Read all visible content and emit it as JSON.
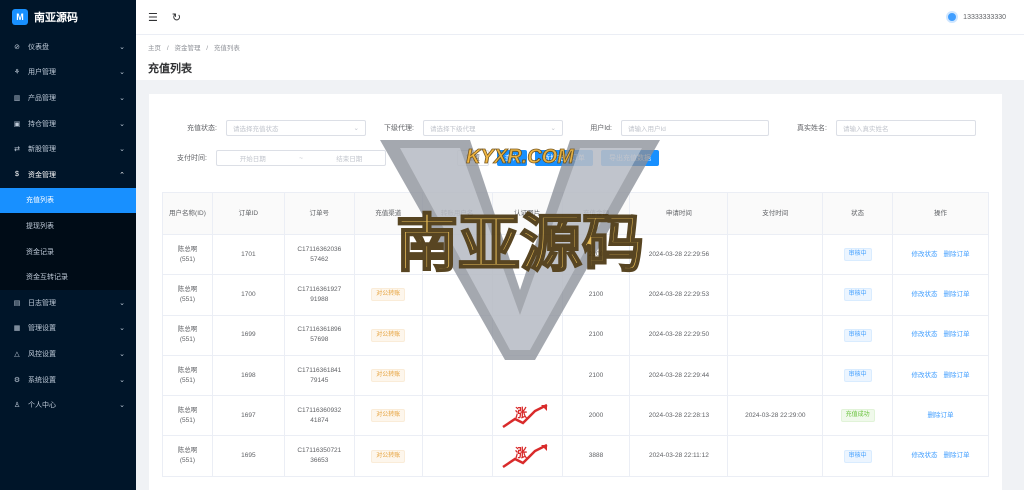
{
  "app": {
    "logo_text": "南亚源码",
    "logo_glyph": "M"
  },
  "sidebar": {
    "items": [
      {
        "label": "仪表盘",
        "icon": "dashboard-icon",
        "glyph": "⊘"
      },
      {
        "label": "用户管理",
        "icon": "users-icon",
        "glyph": "⚘"
      },
      {
        "label": "产品管理",
        "icon": "chart-icon",
        "glyph": "▥"
      },
      {
        "label": "持仓管理",
        "icon": "portfolio-icon",
        "glyph": "▣"
      },
      {
        "label": "新股管理",
        "icon": "ipo-icon",
        "glyph": "⇄"
      },
      {
        "label": "资金管理",
        "icon": "money-icon",
        "glyph": "$"
      }
    ],
    "sub_items": [
      "充值列表",
      "提现列表",
      "资金记录",
      "资金互转记录"
    ],
    "items2": [
      {
        "label": "日志管理",
        "icon": "log-icon",
        "glyph": "▤"
      },
      {
        "label": "管理设置",
        "icon": "settings-grid-icon",
        "glyph": "▦"
      },
      {
        "label": "风控设置",
        "icon": "warning-icon",
        "glyph": "△"
      },
      {
        "label": "系统设置",
        "icon": "gear-icon",
        "glyph": "⚙"
      },
      {
        "label": "个人中心",
        "icon": "person-icon",
        "glyph": "♙"
      }
    ]
  },
  "topbar": {
    "menu_glyph": "☰",
    "refresh_glyph": "↻",
    "username": "13333333330"
  },
  "breadcrumb": [
    "主页",
    "/",
    "资金管理",
    "/",
    "充值列表"
  ],
  "page_title": "充值列表",
  "filters": {
    "status_label": "充值状态:",
    "status_placeholder": "请选择充值状态",
    "agent_label": "下级代理:",
    "agent_placeholder": "请选择下级代理",
    "userid_label": "用户Id:",
    "userid_placeholder": "请输入用户Id",
    "realname_label": "真实姓名:",
    "realname_placeholder": "请输入真实姓名",
    "paytime_label": "支付时间:",
    "start_placeholder": "开始日期",
    "range_sep": "~",
    "end_placeholder": "结束日期",
    "search_btn": "查询",
    "reset_btn": "重置",
    "add_btn": "新增充值订单",
    "export_btn": "导出充值数据"
  },
  "table": {
    "headers": [
      "用户名称(ID)",
      "订单ID",
      "订单号",
      "充值渠道",
      "转账用户名",
      "认证图片",
      "充值金额",
      "申请时间",
      "支付时间",
      "状态",
      "操作"
    ],
    "rows": [
      {
        "user": "陈总啊",
        "uid": "(551)",
        "id": "1701",
        "order1": "C17116362036",
        "order2": "57462",
        "channel": "",
        "img": "",
        "amount": "2100",
        "apply": "2024-03-28 22:29:56",
        "paid": "",
        "status": "审核中",
        "status_color": "blue",
        "ops": [
          "修改状态",
          "删除订单"
        ]
      },
      {
        "user": "陈总啊",
        "uid": "(551)",
        "id": "1700",
        "order1": "C17116361927",
        "order2": "91988",
        "channel": "对公转账",
        "img": "",
        "amount": "2100",
        "apply": "2024-03-28 22:29:53",
        "paid": "",
        "status": "审核中",
        "status_color": "blue",
        "ops": [
          "修改状态",
          "删除订单"
        ]
      },
      {
        "user": "陈总啊",
        "uid": "(551)",
        "id": "1699",
        "order1": "C17116361896",
        "order2": "57698",
        "channel": "对公转账",
        "img": "",
        "amount": "2100",
        "apply": "2024-03-28 22:29:50",
        "paid": "",
        "status": "审核中",
        "status_color": "blue",
        "ops": [
          "修改状态",
          "删除订单"
        ]
      },
      {
        "user": "陈总啊",
        "uid": "(551)",
        "id": "1698",
        "order1": "C17116361841",
        "order2": "79145",
        "channel": "对公转账",
        "img": "",
        "amount": "2100",
        "apply": "2024-03-28 22:29:44",
        "paid": "",
        "status": "审核中",
        "status_color": "blue",
        "ops": [
          "修改状态",
          "删除订单"
        ]
      },
      {
        "user": "陈总啊",
        "uid": "(551)",
        "id": "1697",
        "order1": "C17116360932",
        "order2": "41874",
        "channel": "对公转账",
        "img": "涨",
        "amount": "2000",
        "apply": "2024-03-28 22:28:13",
        "paid": "2024-03-28 22:29:00",
        "status": "充值成功",
        "status_color": "green",
        "ops": [
          "删除订单"
        ]
      },
      {
        "user": "陈总啊",
        "uid": "(551)",
        "id": "1695",
        "order1": "C17116350721",
        "order2": "36653",
        "channel": "对公转账",
        "img": "涨",
        "amount": "3888",
        "apply": "2024-03-28 22:11:12",
        "paid": "",
        "status": "审核中",
        "status_color": "blue",
        "ops": [
          "修改状态",
          "删除订单"
        ]
      }
    ]
  },
  "watermark": {
    "top": "KYXR.COM",
    "main": "南亚源码"
  },
  "colors": {
    "sidebar": "#001529",
    "accent": "#1890ff"
  }
}
